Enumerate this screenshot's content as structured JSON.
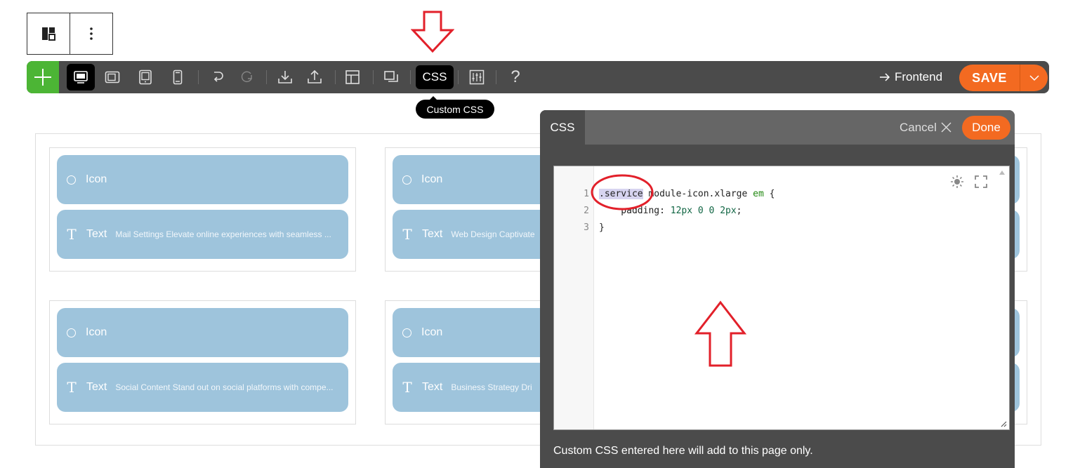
{
  "mini_toolbar": {
    "layout_icon": "layout-icon",
    "more_icon": "more-vertical-icon"
  },
  "toolbar": {
    "add_icon": "plus-icon",
    "css_label": "CSS",
    "help_label": "?",
    "frontend_label": "Frontend",
    "save_label": "SAVE"
  },
  "tooltip": {
    "label": "Custom CSS"
  },
  "canvas": {
    "cards": [
      {
        "icon_label": "Icon",
        "text_label": "Text",
        "text_preview": "Mail Settings Elevate online experiences with seamless ..."
      },
      {
        "icon_label": "Icon",
        "text_label": "Text",
        "text_preview": "Web Design Captivate"
      },
      {
        "icon_label": "Icon",
        "text_label": "Text",
        "text_preview": "Social Content Stand out on social platforms with compe..."
      },
      {
        "icon_label": "Icon",
        "text_label": "Text",
        "text_preview": "Business Strategy Dri"
      }
    ]
  },
  "css_panel": {
    "tab_label": "CSS",
    "cancel_label": "Cancel",
    "done_label": "Done",
    "code_lines": [
      {
        "num": "1",
        "selector_highlight": ".service",
        "rest": " module-icon.xlarge ",
        "keyword": "em",
        "end": " {"
      },
      {
        "num": "2",
        "prop": "    padding: ",
        "value": "12px 0 0 2px",
        "end": ";"
      },
      {
        "num": "3",
        "text": "}"
      }
    ],
    "note": "Custom CSS entered here will add to this page only."
  },
  "colors": {
    "accent_orange": "#f36a21",
    "add_green": "#4cb535",
    "toolbar_bg": "#4b4b4b",
    "module_blue": "#9ec4dc",
    "annotation_red": "#e2202a"
  }
}
